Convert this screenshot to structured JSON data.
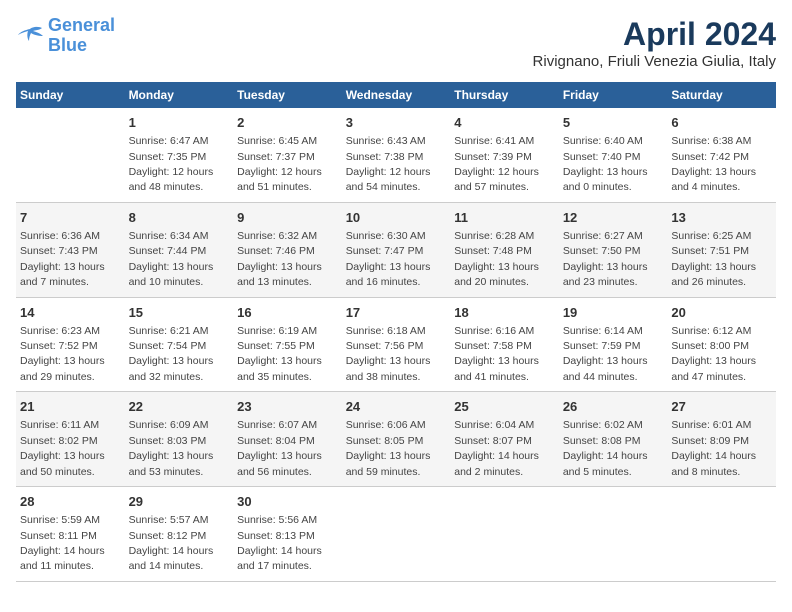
{
  "header": {
    "logo_line1": "General",
    "logo_line2": "Blue",
    "title": "April 2024",
    "subtitle": "Rivignano, Friuli Venezia Giulia, Italy"
  },
  "days_of_week": [
    "Sunday",
    "Monday",
    "Tuesday",
    "Wednesday",
    "Thursday",
    "Friday",
    "Saturday"
  ],
  "weeks": [
    [
      {
        "day": "",
        "info": ""
      },
      {
        "day": "1",
        "info": "Sunrise: 6:47 AM\nSunset: 7:35 PM\nDaylight: 12 hours\nand 48 minutes."
      },
      {
        "day": "2",
        "info": "Sunrise: 6:45 AM\nSunset: 7:37 PM\nDaylight: 12 hours\nand 51 minutes."
      },
      {
        "day": "3",
        "info": "Sunrise: 6:43 AM\nSunset: 7:38 PM\nDaylight: 12 hours\nand 54 minutes."
      },
      {
        "day": "4",
        "info": "Sunrise: 6:41 AM\nSunset: 7:39 PM\nDaylight: 12 hours\nand 57 minutes."
      },
      {
        "day": "5",
        "info": "Sunrise: 6:40 AM\nSunset: 7:40 PM\nDaylight: 13 hours\nand 0 minutes."
      },
      {
        "day": "6",
        "info": "Sunrise: 6:38 AM\nSunset: 7:42 PM\nDaylight: 13 hours\nand 4 minutes."
      }
    ],
    [
      {
        "day": "7",
        "info": "Sunrise: 6:36 AM\nSunset: 7:43 PM\nDaylight: 13 hours\nand 7 minutes."
      },
      {
        "day": "8",
        "info": "Sunrise: 6:34 AM\nSunset: 7:44 PM\nDaylight: 13 hours\nand 10 minutes."
      },
      {
        "day": "9",
        "info": "Sunrise: 6:32 AM\nSunset: 7:46 PM\nDaylight: 13 hours\nand 13 minutes."
      },
      {
        "day": "10",
        "info": "Sunrise: 6:30 AM\nSunset: 7:47 PM\nDaylight: 13 hours\nand 16 minutes."
      },
      {
        "day": "11",
        "info": "Sunrise: 6:28 AM\nSunset: 7:48 PM\nDaylight: 13 hours\nand 20 minutes."
      },
      {
        "day": "12",
        "info": "Sunrise: 6:27 AM\nSunset: 7:50 PM\nDaylight: 13 hours\nand 23 minutes."
      },
      {
        "day": "13",
        "info": "Sunrise: 6:25 AM\nSunset: 7:51 PM\nDaylight: 13 hours\nand 26 minutes."
      }
    ],
    [
      {
        "day": "14",
        "info": "Sunrise: 6:23 AM\nSunset: 7:52 PM\nDaylight: 13 hours\nand 29 minutes."
      },
      {
        "day": "15",
        "info": "Sunrise: 6:21 AM\nSunset: 7:54 PM\nDaylight: 13 hours\nand 32 minutes."
      },
      {
        "day": "16",
        "info": "Sunrise: 6:19 AM\nSunset: 7:55 PM\nDaylight: 13 hours\nand 35 minutes."
      },
      {
        "day": "17",
        "info": "Sunrise: 6:18 AM\nSunset: 7:56 PM\nDaylight: 13 hours\nand 38 minutes."
      },
      {
        "day": "18",
        "info": "Sunrise: 6:16 AM\nSunset: 7:58 PM\nDaylight: 13 hours\nand 41 minutes."
      },
      {
        "day": "19",
        "info": "Sunrise: 6:14 AM\nSunset: 7:59 PM\nDaylight: 13 hours\nand 44 minutes."
      },
      {
        "day": "20",
        "info": "Sunrise: 6:12 AM\nSunset: 8:00 PM\nDaylight: 13 hours\nand 47 minutes."
      }
    ],
    [
      {
        "day": "21",
        "info": "Sunrise: 6:11 AM\nSunset: 8:02 PM\nDaylight: 13 hours\nand 50 minutes."
      },
      {
        "day": "22",
        "info": "Sunrise: 6:09 AM\nSunset: 8:03 PM\nDaylight: 13 hours\nand 53 minutes."
      },
      {
        "day": "23",
        "info": "Sunrise: 6:07 AM\nSunset: 8:04 PM\nDaylight: 13 hours\nand 56 minutes."
      },
      {
        "day": "24",
        "info": "Sunrise: 6:06 AM\nSunset: 8:05 PM\nDaylight: 13 hours\nand 59 minutes."
      },
      {
        "day": "25",
        "info": "Sunrise: 6:04 AM\nSunset: 8:07 PM\nDaylight: 14 hours\nand 2 minutes."
      },
      {
        "day": "26",
        "info": "Sunrise: 6:02 AM\nSunset: 8:08 PM\nDaylight: 14 hours\nand 5 minutes."
      },
      {
        "day": "27",
        "info": "Sunrise: 6:01 AM\nSunset: 8:09 PM\nDaylight: 14 hours\nand 8 minutes."
      }
    ],
    [
      {
        "day": "28",
        "info": "Sunrise: 5:59 AM\nSunset: 8:11 PM\nDaylight: 14 hours\nand 11 minutes."
      },
      {
        "day": "29",
        "info": "Sunrise: 5:57 AM\nSunset: 8:12 PM\nDaylight: 14 hours\nand 14 minutes."
      },
      {
        "day": "30",
        "info": "Sunrise: 5:56 AM\nSunset: 8:13 PM\nDaylight: 14 hours\nand 17 minutes."
      },
      {
        "day": "",
        "info": ""
      },
      {
        "day": "",
        "info": ""
      },
      {
        "day": "",
        "info": ""
      },
      {
        "day": "",
        "info": ""
      }
    ]
  ]
}
